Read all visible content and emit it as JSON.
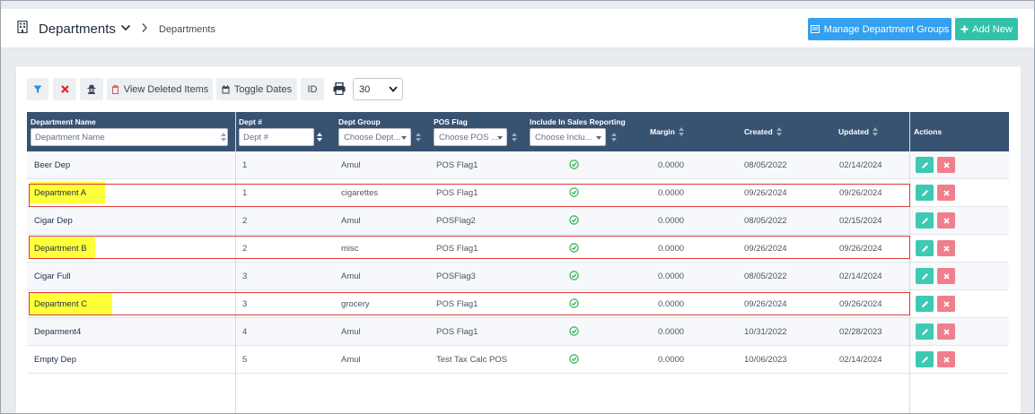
{
  "header": {
    "title": "Departments",
    "breadcrumb": "Departments",
    "manage_groups_label": "Manage Department Groups",
    "add_new_label": "Add New"
  },
  "toolbar": {
    "view_deleted_label": "View Deleted Items",
    "toggle_dates_label": "Toggle Dates",
    "id_label": "ID",
    "page_size": "30"
  },
  "table": {
    "columns": {
      "department_name": "Department Name",
      "dept_no": "Dept #",
      "dept_group": "Dept Group",
      "pos_flag": "POS Flag",
      "include_sales": "Include In Sales Reporting",
      "margin": "Margin",
      "created": "Created",
      "updated": "Updated",
      "actions": "Actions"
    },
    "filters": {
      "department_name_placeholder": "Department Name",
      "dept_no_placeholder": "Dept #",
      "dept_group_placeholder": "Choose Dept...",
      "pos_flag_placeholder": "Choose POS ...",
      "include_sales_placeholder": "Choose Inclu..."
    },
    "rows": [
      {
        "name": "Beer Dep",
        "dept_no": "1",
        "group": "Amul",
        "pos_flag": "POS Flag1",
        "margin": "0.0000",
        "created": "08/05/2022",
        "updated": "02/14/2024",
        "highlighted": false
      },
      {
        "name": "Department A",
        "dept_no": "1",
        "group": "cigarettes",
        "pos_flag": "POS Flag1",
        "margin": "0.0000",
        "created": "09/26/2024",
        "updated": "09/26/2024",
        "highlighted": true
      },
      {
        "name": "Cigar Dep",
        "dept_no": "2",
        "group": "Amul",
        "pos_flag": "POSFlag2",
        "margin": "0.0000",
        "created": "08/05/2022",
        "updated": "02/15/2024",
        "highlighted": false
      },
      {
        "name": "Department B",
        "dept_no": "2",
        "group": "misc",
        "pos_flag": "POS Flag1",
        "margin": "0.0000",
        "created": "09/26/2024",
        "updated": "09/26/2024",
        "highlighted": true
      },
      {
        "name": "Cigar Full",
        "dept_no": "3",
        "group": "Amul",
        "pos_flag": "POSFlag3",
        "margin": "0.0000",
        "created": "08/05/2022",
        "updated": "02/14/2024",
        "highlighted": false
      },
      {
        "name": "Department C",
        "dept_no": "3",
        "group": "grocery",
        "pos_flag": "POS Flag1",
        "margin": "0.0000",
        "created": "09/26/2024",
        "updated": "09/26/2024",
        "highlighted": true
      },
      {
        "name": "Deparment4",
        "dept_no": "4",
        "group": "Amul",
        "pos_flag": "POS Flag1",
        "margin": "0.0000",
        "created": "10/31/2022",
        "updated": "02/28/2023",
        "highlighted": false
      },
      {
        "name": "Empty Dep",
        "dept_no": "5",
        "group": "Amul",
        "pos_flag": "Test Tax Calc POS",
        "margin": "0.0000",
        "created": "10/06/2023",
        "updated": "02/14/2024",
        "highlighted": false
      }
    ]
  },
  "colors": {
    "primary": "#33a0f1",
    "success": "#31c2a8",
    "header_bg": "#385272",
    "danger": "#f07f8e",
    "highlight": "#ffff3a",
    "annotation": "#d93a3a"
  }
}
